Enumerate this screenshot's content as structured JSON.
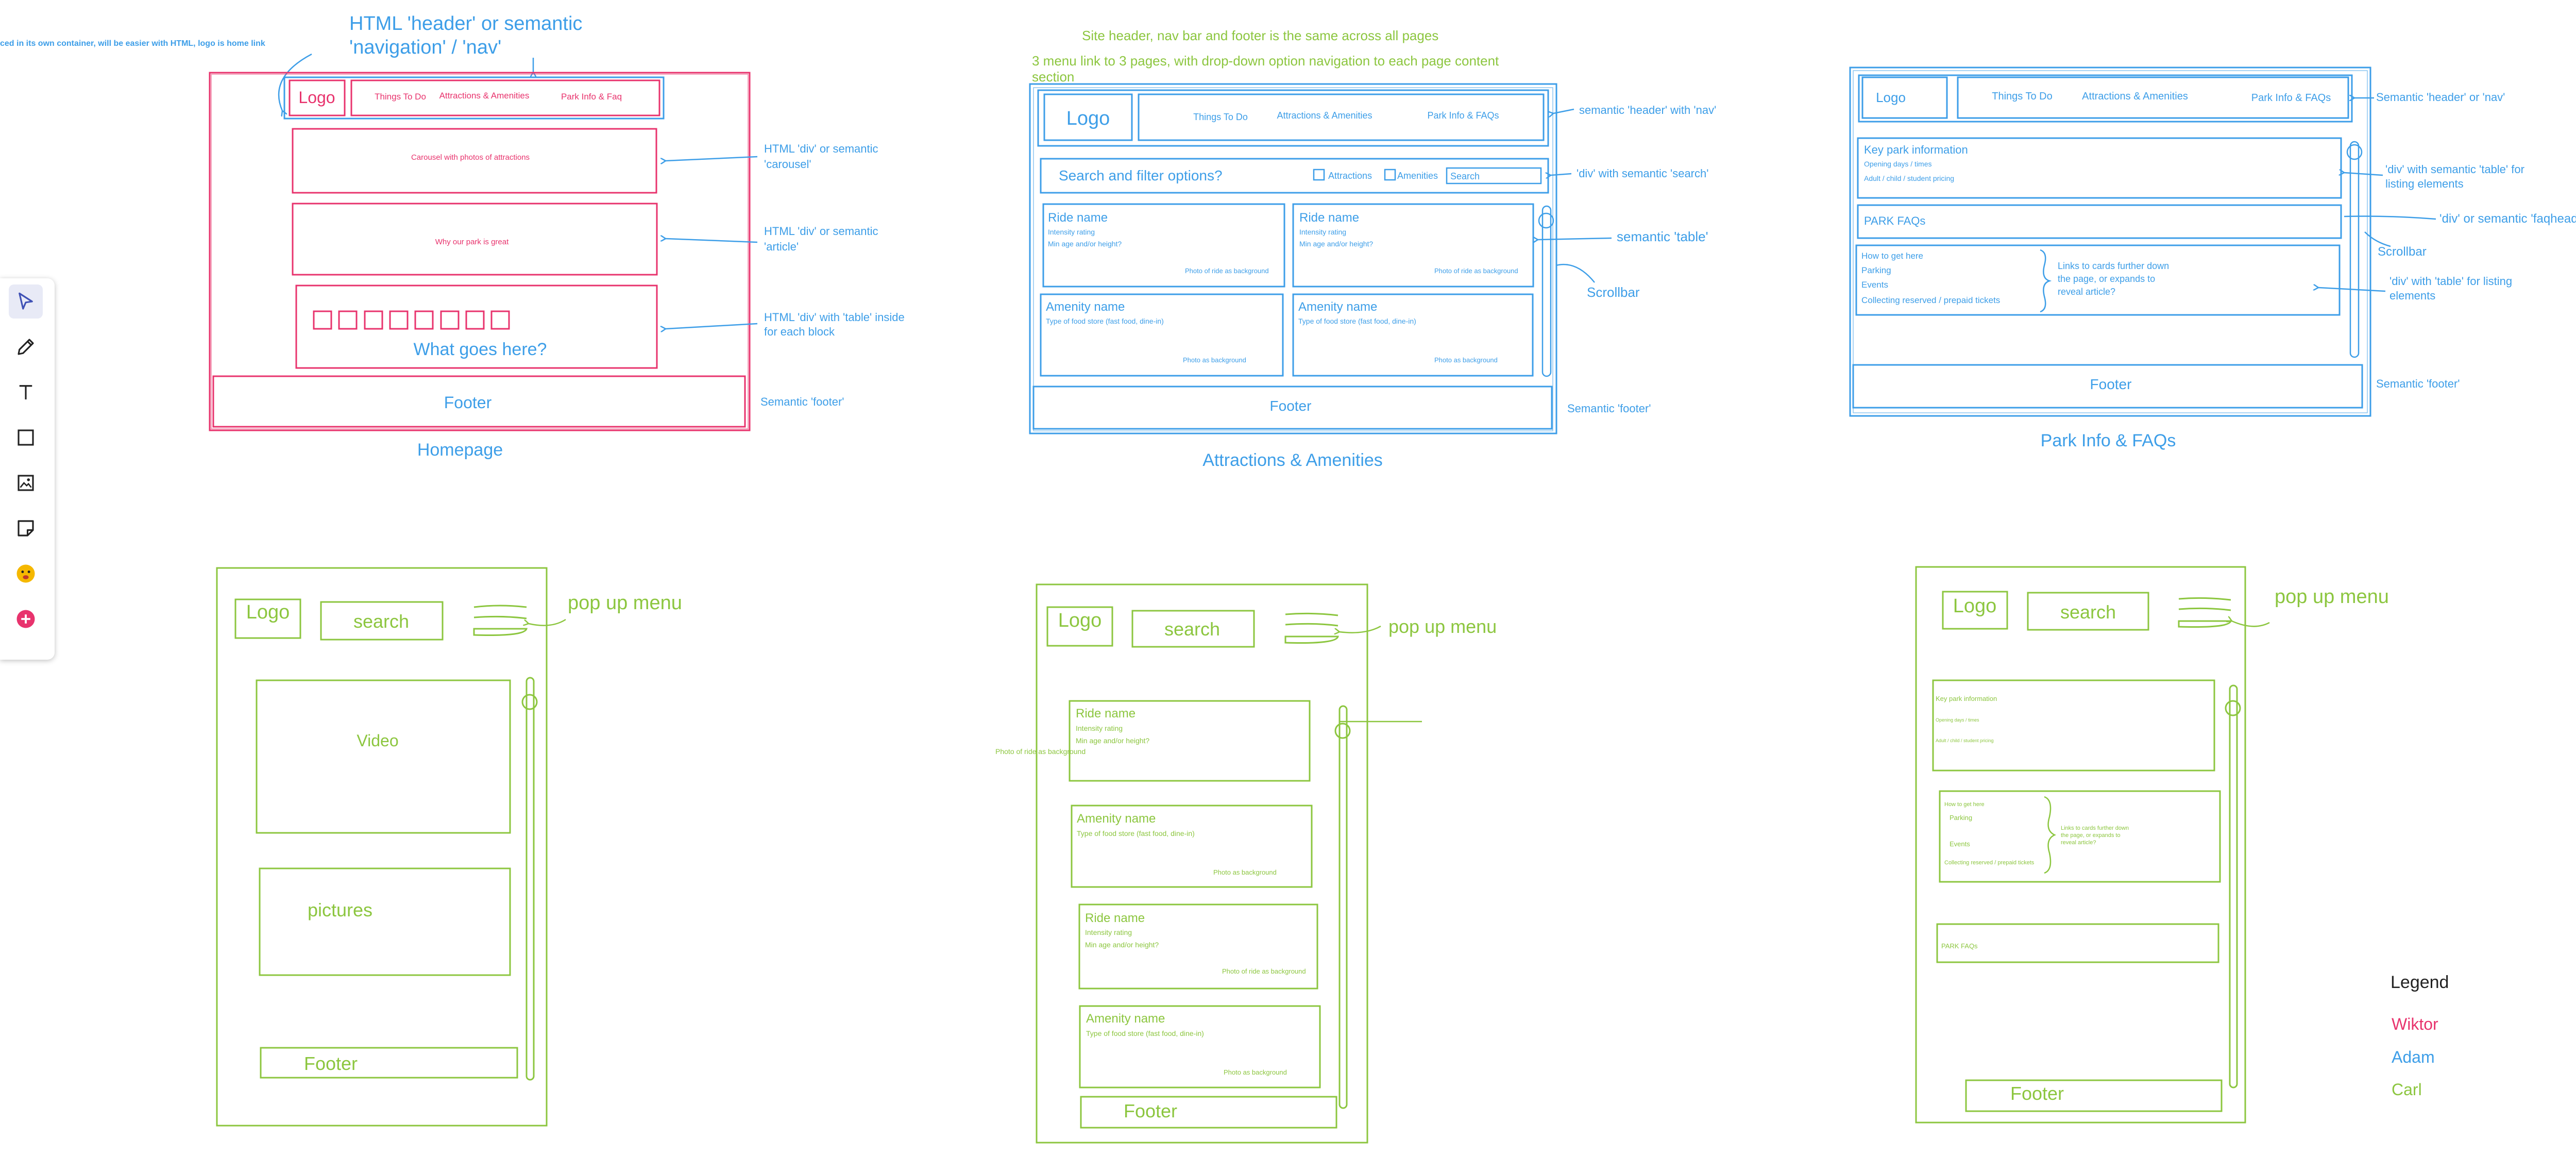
{
  "colors": {
    "wiktor": "#e8336d",
    "adam": "#3d9ee8",
    "carl": "#8cc63f",
    "ink": "#222222"
  },
  "toolbar": {
    "tools": [
      "select-icon",
      "pencil-icon",
      "text-icon",
      "rectangle-icon",
      "image-icon",
      "sticky-note-icon",
      "emoji-icon",
      "add-icon"
    ]
  },
  "top_notes": {
    "container_note": "ced in its own container, will be easier with HTML, logo is home link",
    "header_note": [
      "HTML 'header' or semantic",
      "'navigation' / 'nav'"
    ],
    "site_note": "Site header, nav bar and footer is the same across all pages",
    "menu_note": [
      "3 menu link to 3 pages, with drop-down option navigation to each page  content",
      "section"
    ]
  },
  "homepage": {
    "title": "Homepage",
    "logo": "Logo",
    "nav": [
      "Things To Do",
      "Attractions & Amenities",
      "Park Info & Faq"
    ],
    "carousel": "Carousel with photos of attractions",
    "article": "Why our park is great",
    "block_text": "What goes here?",
    "footer": "Footer",
    "annotations": {
      "carousel": [
        "HTML 'div' or semantic",
        "'carousel'"
      ],
      "article": [
        "HTML 'div' or semantic",
        "'article'"
      ],
      "table": [
        "HTML 'div' with 'table' inside",
        "for each block"
      ],
      "footer": "Semantic 'footer'"
    }
  },
  "attractions": {
    "title": "Attractions & Amenities",
    "logo": "Logo",
    "nav": [
      "Things To Do",
      "Attractions & Amenities",
      "Park Info & FAQs"
    ],
    "search_label": "Search and filter options?",
    "filters": [
      "Attractions",
      "Amenities"
    ],
    "search_placeholder": "Search",
    "ride": {
      "name": "Ride name",
      "rating": "Intensity rating",
      "age": "Min age and/or height?",
      "photo": "Photo of ride as background"
    },
    "amenity": {
      "name": "Amenity name",
      "type": "Type of food store (fast food, dine-in)",
      "photo": "Photo as background"
    },
    "footer": "Footer",
    "annotations": {
      "header": "semantic 'header' with 'nav'",
      "search": "'div' with semantic 'search'",
      "table": "semantic 'table'",
      "scrollbar": "Scrollbar",
      "footer": "Semantic 'footer'"
    }
  },
  "parkinfo": {
    "title": "Park Info & FAQs",
    "logo": "Logo",
    "nav": [
      "Things To Do",
      "Attractions & Amenities",
      "Park Info & FAQs"
    ],
    "key_info": {
      "title": "Key park information",
      "lines": [
        "Opening days / times",
        "Adult / child / student pricing"
      ]
    },
    "faq": "PARK FAQs",
    "links": [
      "How to get here",
      "Parking",
      "Events",
      "Collecting reserved / prepaid tickets"
    ],
    "links_note": [
      "Links to cards further down",
      "the page, or expands to",
      "reveal article?"
    ],
    "footer": "Footer",
    "annotations": {
      "header": "Semantic 'header' or 'nav'",
      "table1": [
        "'div' with semantic 'table' for",
        "listing elements"
      ],
      "faq": "'div' or semantic 'faqheader'",
      "scrollbar": "Scrollbar",
      "table2": [
        "'div' with 'table' for listing",
        "elements"
      ],
      "footer": "Semantic 'footer'"
    }
  },
  "mobile_home": {
    "logo": "Logo",
    "search": "search",
    "popup": "pop up menu",
    "video": "Video",
    "pictures": "pictures",
    "footer": "Footer"
  },
  "mobile_attr": {
    "logo": "Logo",
    "search": "search",
    "popup": "pop up menu",
    "side_note": "Photo of ride as background",
    "ride": {
      "name": "Ride name",
      "rating": "Intensity rating",
      "age": "Min age and/or height?",
      "photo": "Photo of ride as background"
    },
    "amenity": {
      "name": "Amenity name",
      "type": "Type of food store (fast food, dine-in)",
      "photo": "Photo as background"
    },
    "footer": "Footer"
  },
  "mobile_info": {
    "logo": "Logo",
    "search": "search",
    "popup": "pop up menu",
    "key_info": {
      "title": "Key park information",
      "lines": [
        "Opening days / times",
        "Adult / child / student pricing"
      ]
    },
    "links": [
      "How to get here",
      "Parking",
      "Events",
      "Collecting reserved / prepaid tickets"
    ],
    "links_note": [
      "Links to cards further down",
      "the page, or expands to",
      "reveal article?"
    ],
    "faq": "PARK FAQs",
    "footer": "Footer"
  },
  "legend": {
    "title": "Legend",
    "items": [
      {
        "name": "Wiktor",
        "color": "#e8336d"
      },
      {
        "name": "Adam",
        "color": "#3d9ee8"
      },
      {
        "name": "Carl",
        "color": "#8cc63f"
      }
    ]
  }
}
